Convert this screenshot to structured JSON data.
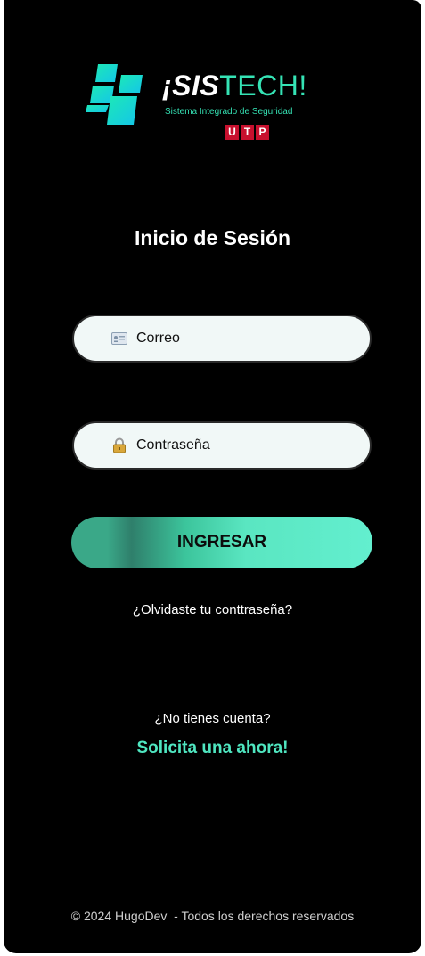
{
  "brand": {
    "title_prefix": "¡SIS",
    "title_suffix": "TECH!",
    "subtitle": "Sistema Integrado de Seguridad",
    "partner_letters": [
      "U",
      "T",
      "P"
    ],
    "accent_color": "#35e3b5",
    "partner_color": "#c8102e"
  },
  "login": {
    "title": "Inicio de Sesión",
    "email_placeholder": "Correo",
    "email_icon": "id-card-icon",
    "password_placeholder": "Contraseña",
    "password_icon": "padlock-icon",
    "submit_label": "INGRESAR",
    "forgot_link": "¿Olvidaste tu conttraseña?"
  },
  "signup": {
    "prompt": "¿No tienes cuenta?",
    "link": "Solicita una ahora!"
  },
  "footer": {
    "text": "© 2024 HugoDev  - Todos los derechos reservados"
  }
}
